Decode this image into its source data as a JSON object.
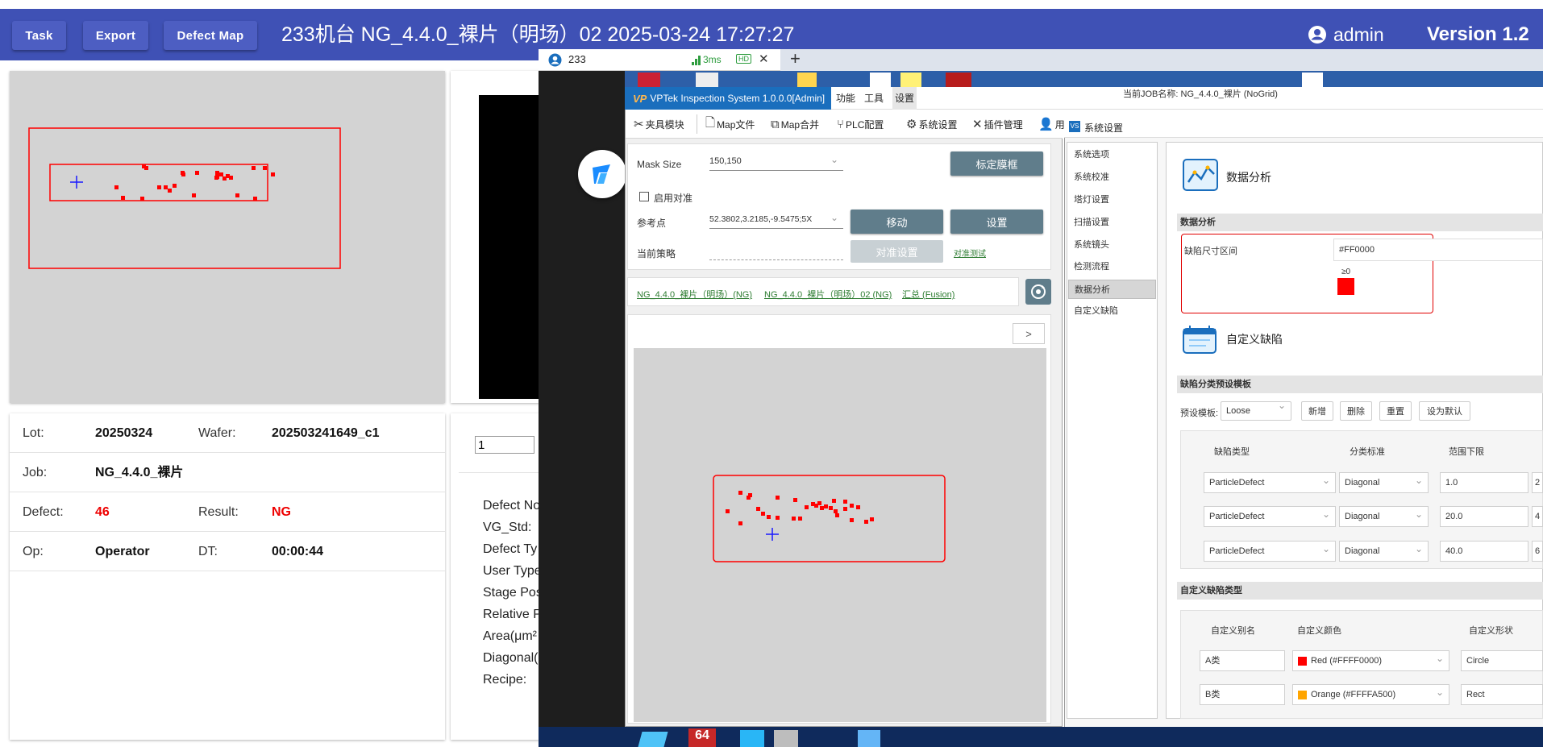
{
  "topbar": {
    "task": "Task",
    "export": "Export",
    "defect_map": "Defect Map",
    "title": "233机台   NG_4.4.0_裸片（明场）02   2025-03-24 17:27:27",
    "user": "admin",
    "version": "Version 1.2"
  },
  "info": {
    "lot_label": "Lot:",
    "lot": "20250324",
    "wafer_label": "Wafer:",
    "wafer": "202503241649_c1",
    "job_label": "Job:",
    "job": "NG_4.4.0_裸片",
    "defect_label": "Defect:",
    "defect": "46",
    "result_label": "Result:",
    "result": "NG",
    "op_label": "Op:",
    "op": "Operator",
    "dt_label": "DT:",
    "dt": "00:00:44"
  },
  "detail": {
    "page_value": "1",
    "labels": [
      "Defect No",
      "VG_Std:",
      "Defect Ty",
      "User Type",
      "Stage Pos",
      "Relative P",
      "Area(μm²",
      "Diagonal(",
      "Recipe:"
    ]
  },
  "remote": {
    "tab_name": "233",
    "latency": "3ms",
    "hd": "HD",
    "close": "✕",
    "new_tab": "+"
  },
  "vptek": {
    "title": "VPTek Inspection System 1.0.0.0[Admin]",
    "menu": [
      "功能",
      "工具",
      "设置"
    ],
    "job_name": "当前JOB名称:  NG_4.4.0_裸片 (NoGrid)",
    "toolbar": [
      "夹具模块",
      "Map文件",
      "Map合并",
      "PLC配置",
      "系统设置",
      "插件管理",
      "用"
    ],
    "mask_size_label": "Mask Size",
    "mask_size_value": "150,150",
    "calibrate_btn": "标定膜框",
    "align_checkbox": "启用对准",
    "ref_point_label": "参考点",
    "ref_point_value": "52.3802,3.2185,-9.5475;5X",
    "move_btn": "移动",
    "set_btn": "设置",
    "strategy_label": "当前策略",
    "align_settings_btn": "对准设置",
    "align_test_link": "对准测试",
    "links": [
      "NG_4.4.0_裸片（明场）(NG)",
      "NG_4.4.0_裸片（明场）02 (NG)",
      "汇总 (Fusion)"
    ],
    "expand_btn": ">"
  },
  "sys": {
    "title": "系统设置",
    "nav": [
      "系统选项",
      "系统校准",
      "塔灯设置",
      "扫描设置",
      "系统镜头",
      "检测流程",
      "数据分析",
      "自定义缺陷"
    ],
    "data_analysis_heading": "数据分析",
    "section_data_analysis": "数据分析",
    "size_range_label": "缺陷尺寸区间",
    "color_value": "#FF0000",
    "ge_zero": "≥0",
    "custom_defect_heading": "自定义缺陷",
    "section_template": "缺陷分类预设模板",
    "preset_label": "预设模板:",
    "preset_value": "Loose",
    "btn_new": "新增",
    "btn_delete": "删除",
    "btn_reset": "重置",
    "btn_default": "设为默认",
    "template_headers": [
      "缺陷类型",
      "分类标准",
      "范围下限"
    ],
    "template_rows": [
      {
        "type": "ParticleDefect",
        "std": "Diagonal",
        "low": "1.0",
        "next": "2"
      },
      {
        "type": "ParticleDefect",
        "std": "Diagonal",
        "low": "20.0",
        "next": "4"
      },
      {
        "type": "ParticleDefect",
        "std": "Diagonal",
        "low": "40.0",
        "next": "6"
      }
    ],
    "section_custom_types": "自定义缺陷类型",
    "custom_headers": [
      "自定义别名",
      "自定义颜色",
      "自定义形状"
    ],
    "custom_rows": [
      {
        "alias": "A类",
        "color": "Red (#FFFF0000)",
        "swatch": "#ff0000",
        "shape": "Circle"
      },
      {
        "alias": "B类",
        "color": "Orange (#FFFFA500)",
        "swatch": "#ffa500",
        "shape": "Rect"
      }
    ]
  },
  "colors": {
    "topbar": "#3f51b5",
    "defect_red": "#ff0000",
    "accent_blue": "#1a6ebd"
  }
}
